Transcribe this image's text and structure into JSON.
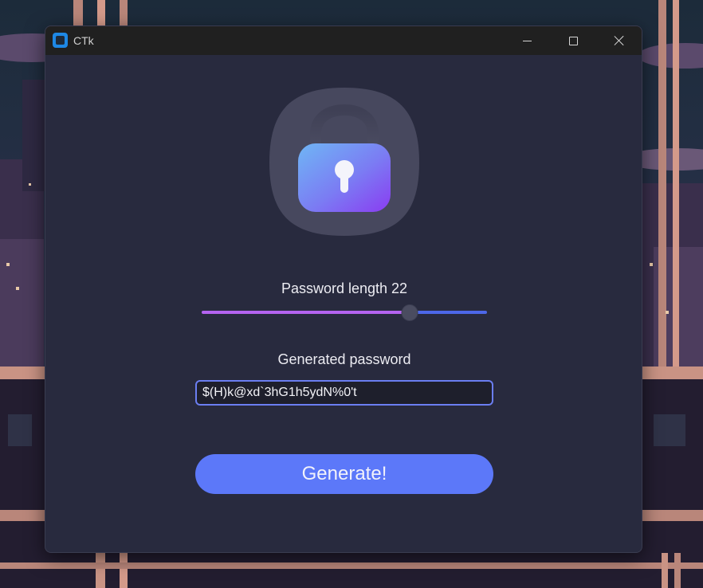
{
  "window": {
    "title": "CTk"
  },
  "icons": {
    "app": "ctk-app-icon",
    "minimize": "minimize-icon",
    "maximize": "maximize-icon",
    "close": "close-icon",
    "lock": "padlock-icon"
  },
  "length": {
    "label": "Password length 22",
    "value": 22,
    "fraction": 0.73
  },
  "password": {
    "label": "Generated password",
    "value": "$(H)k@xd`3hG1h5ydN%0't"
  },
  "generate": {
    "label": "Generate!"
  },
  "colors": {
    "accent": "#5c78f9",
    "slider_fill": "#b463f0",
    "slider_rest": "#4d67e8",
    "window_bg": "#282a3e"
  }
}
